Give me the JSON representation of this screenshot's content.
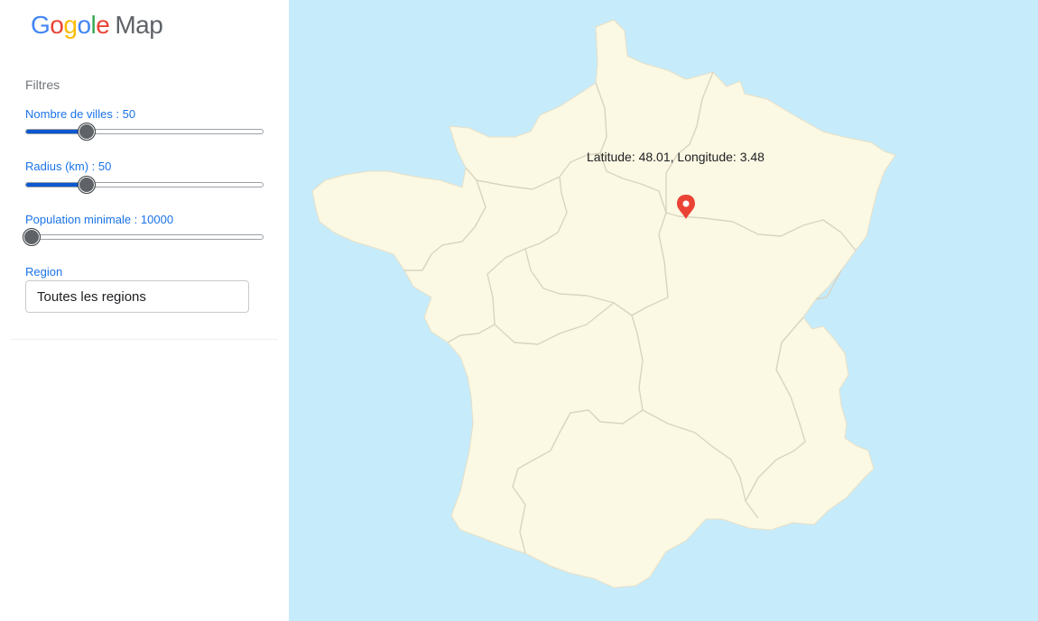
{
  "logo": {
    "letters": [
      {
        "ch": "G",
        "color": "#4285F4"
      },
      {
        "ch": "o",
        "color": "#EA4335"
      },
      {
        "ch": "g",
        "color": "#FBBC05"
      },
      {
        "ch": "o",
        "color": "#4285F4"
      },
      {
        "ch": "l",
        "color": "#34A853"
      },
      {
        "ch": "e",
        "color": "#EA4335"
      }
    ],
    "map_word": "Map"
  },
  "filters": {
    "title": "Filtres",
    "cities": {
      "label": "Nombre de villes : 50",
      "value": 50,
      "min": 0,
      "max": 200
    },
    "radius": {
      "label": "Radius (km) : 50",
      "value": 50,
      "min": 0,
      "max": 200
    },
    "population": {
      "label": "Population minimale : 10000",
      "value": 10000,
      "min": 0,
      "max": 500000
    },
    "region": {
      "label": "Region",
      "selected": "Toutes les regions"
    }
  },
  "map": {
    "coordinates_text": "Latitude: 48.01, Longitude: 3.48",
    "marker_icon": "map-pin-icon",
    "colors": {
      "water": "#c6ecfc",
      "land": "#fbf8e3",
      "borders": "#d9d4c2",
      "marker": "#ea4335"
    }
  }
}
